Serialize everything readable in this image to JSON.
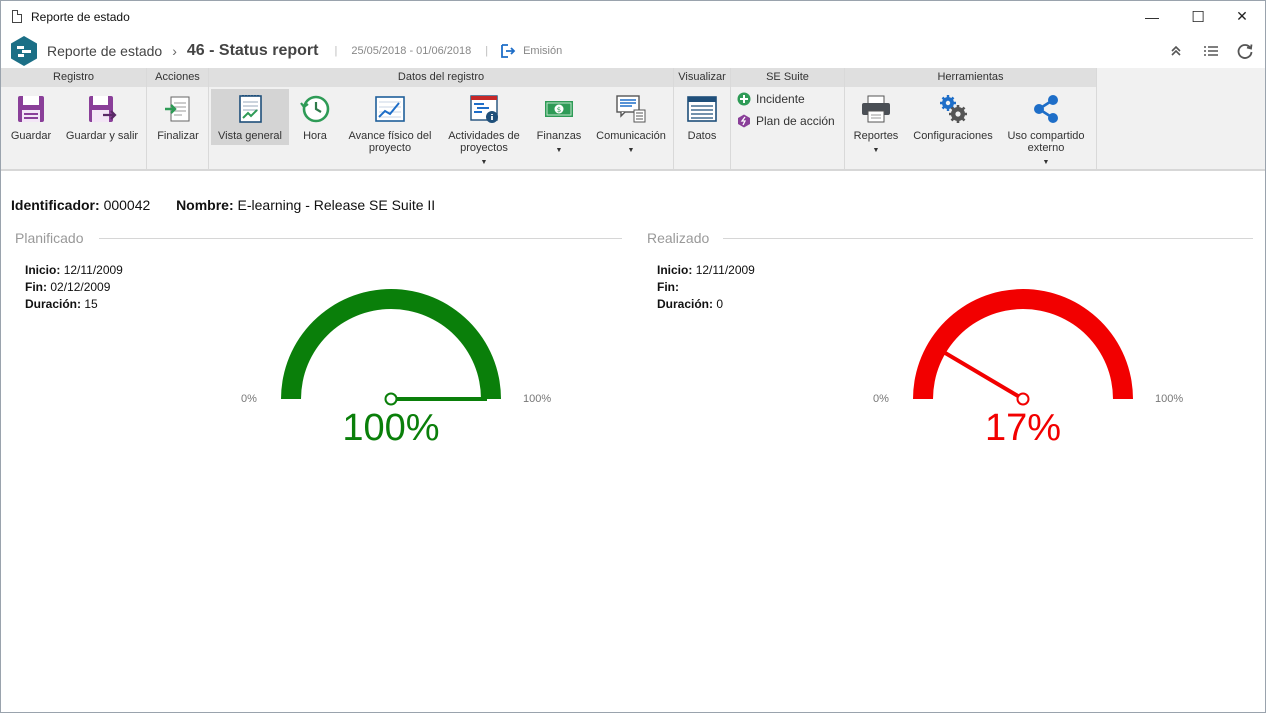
{
  "window": {
    "title": "Reporte de estado",
    "controls": {
      "minimize": "—",
      "maximize": "☐",
      "close": "✕"
    }
  },
  "header": {
    "crumb_app": "Reporte de estado",
    "crumb_separator": "›",
    "crumb_record": "46 - Status report",
    "divider": "|",
    "date_range": "25/05/2018 - 01/06/2018",
    "emission_label": "Emisión"
  },
  "ribbon": {
    "groups": {
      "registro": "Registro",
      "acciones": "Acciones",
      "datos_registro": "Datos del registro",
      "visualizar": "Visualizar",
      "se_suite": "SE Suite",
      "herramientas": "Herramientas"
    },
    "buttons": {
      "guardar": "Guardar",
      "guardar_salir": "Guardar y salir",
      "finalizar": "Finalizar",
      "vista_general": "Vista general",
      "hora": "Hora",
      "avance_fisico_1": "Avance físico del",
      "avance_fisico_2": "proyecto",
      "actividades_1": "Actividades de",
      "actividades_2": "proyectos",
      "finanzas": "Finanzas",
      "comunicacion": "Comunicación",
      "datos": "Datos",
      "incidente": "Incidente",
      "plan_accion": "Plan de acción",
      "reportes": "Reportes",
      "configuraciones": "Configuraciones",
      "uso_compartido_1": "Uso compartido",
      "uso_compartido_2": "externo"
    },
    "caret": "▼"
  },
  "record": {
    "id_label": "Identificador:",
    "id_value": "000042",
    "name_label": "Nombre:",
    "name_value": "E-learning - Release SE Suite II"
  },
  "planned": {
    "title": "Planificado",
    "start_label": "Inicio:",
    "start_value": "12/11/2009",
    "end_label": "Fin:",
    "end_value": "02/12/2009",
    "duration_label": "Duración:",
    "duration_value": "15",
    "gauge": {
      "value": 100,
      "display": "100%",
      "min_label": "0%",
      "max_label": "100%",
      "color": "#0a7f0a"
    }
  },
  "actual": {
    "title": "Realizado",
    "start_label": "Inicio:",
    "start_value": "12/11/2009",
    "end_label": "Fin:",
    "end_value": "",
    "duration_label": "Duración:",
    "duration_value": "0",
    "gauge": {
      "value": 17,
      "display": "17%",
      "min_label": "0%",
      "max_label": "100%",
      "color": "#f20000"
    }
  },
  "icons": {
    "logo": "se-suite-logo-icon",
    "header_actions": [
      "collapse-icon",
      "list-icon",
      "refresh-icon"
    ]
  }
}
